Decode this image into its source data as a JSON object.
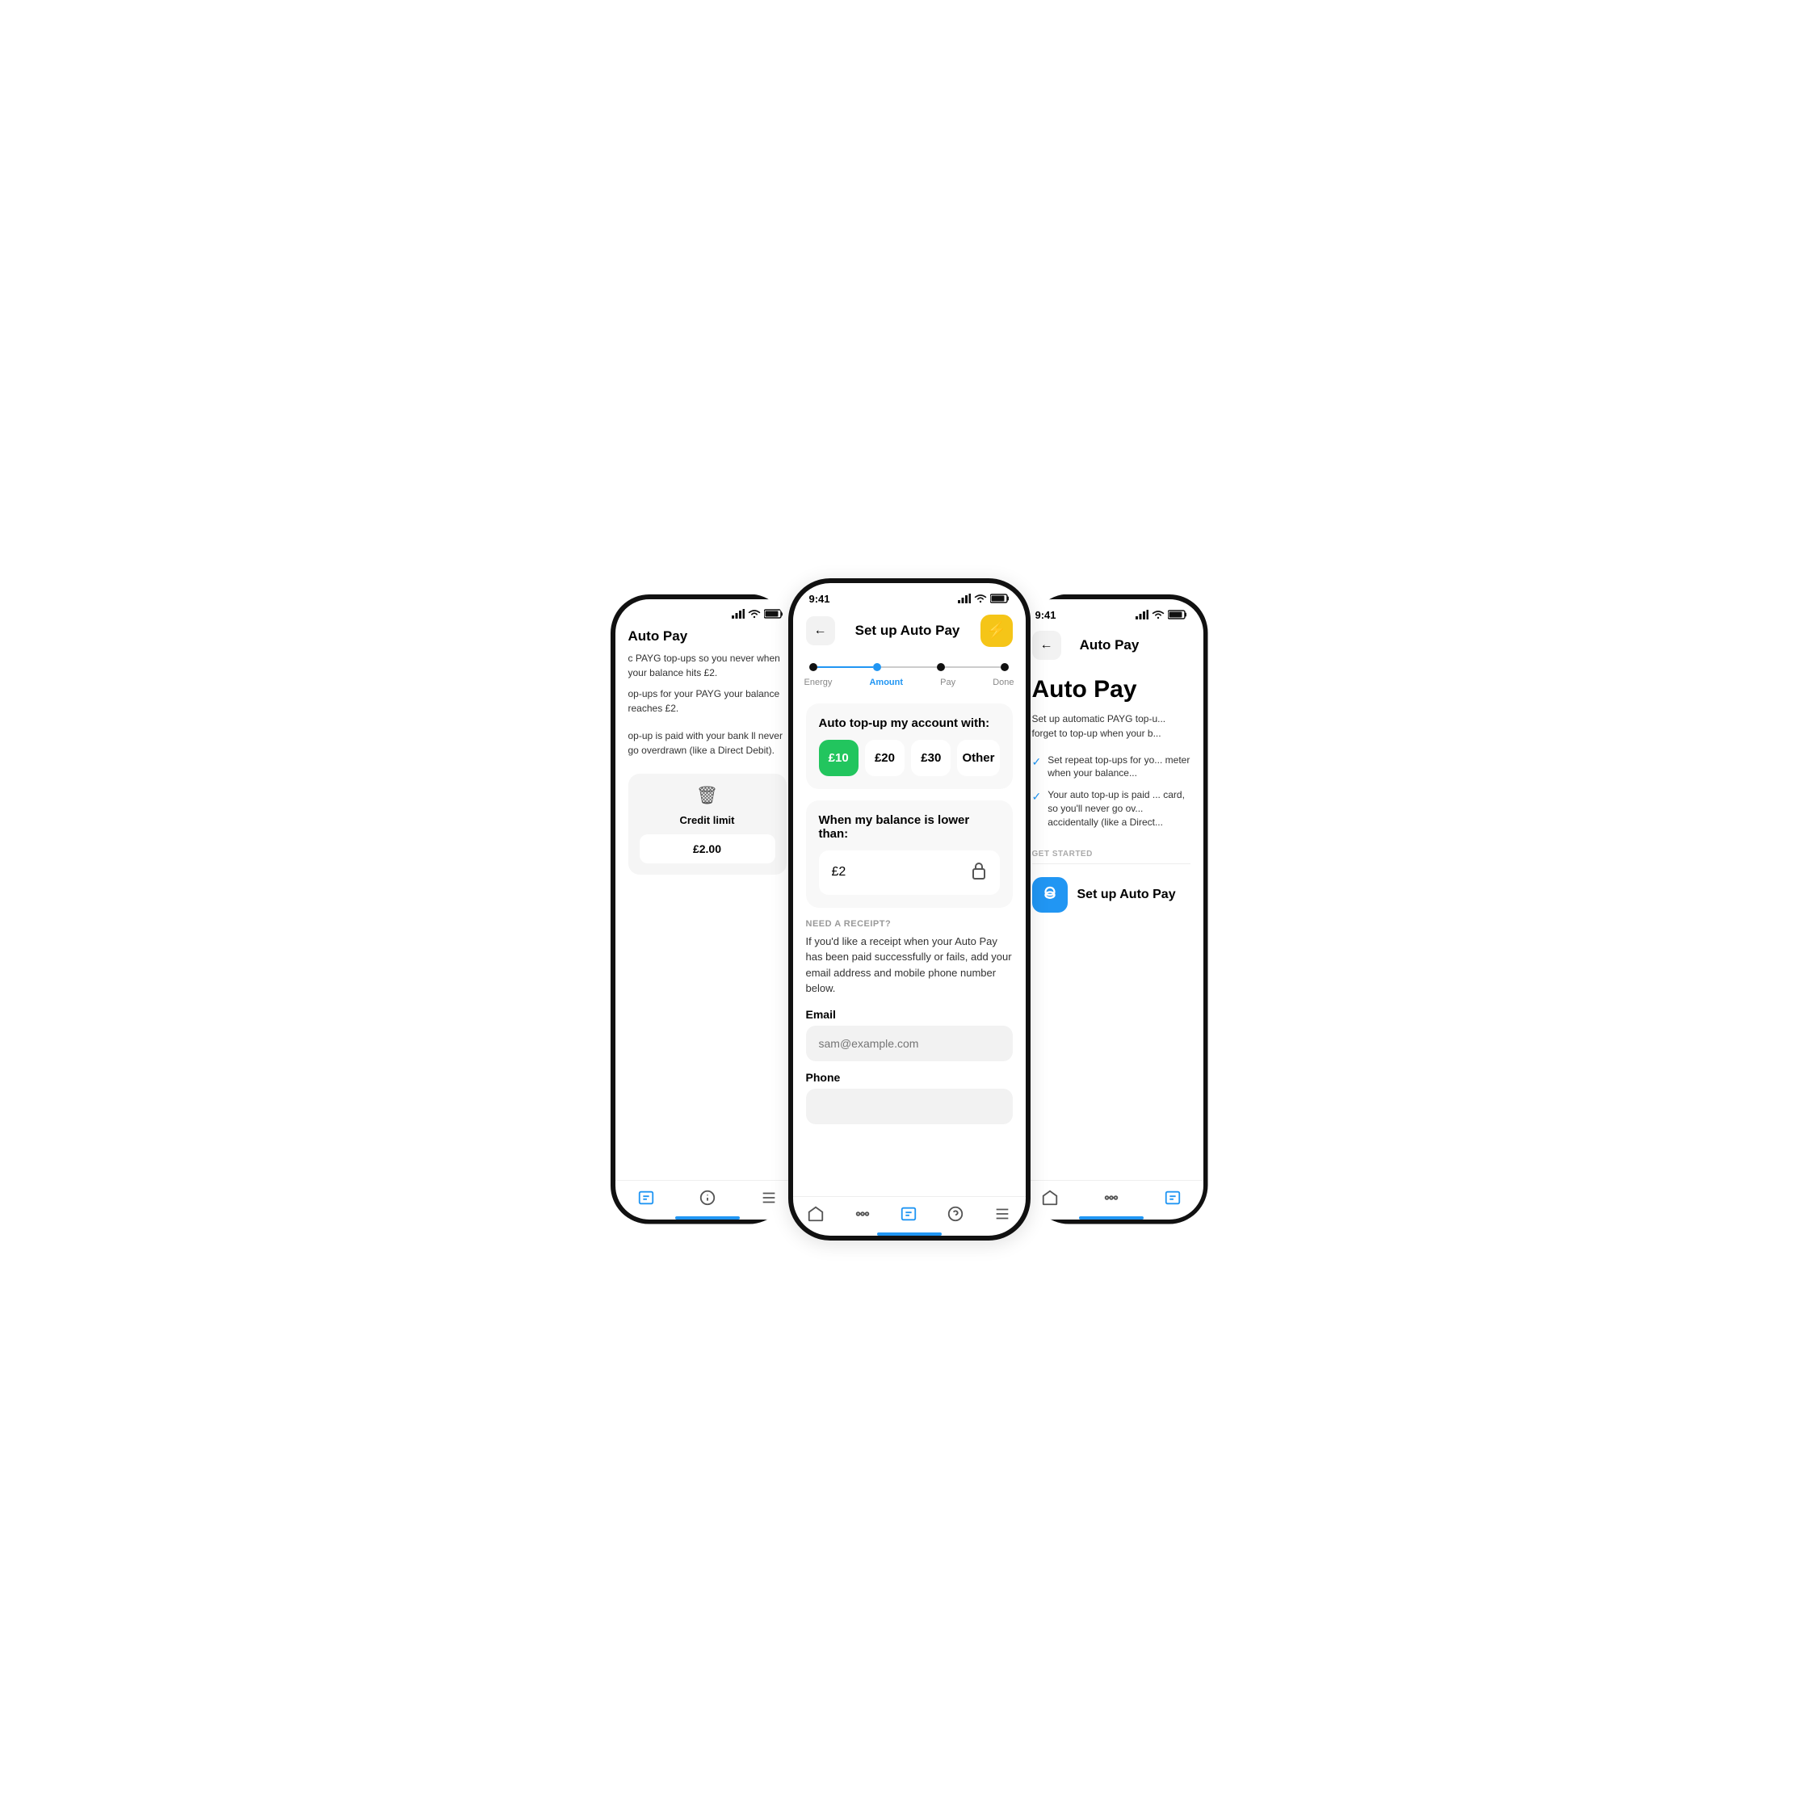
{
  "left_phone": {
    "title": "Auto Pay",
    "desc1": "c PAYG top-ups so you never when your balance hits £2.",
    "desc2": "op-ups for your PAYG your balance reaches £2.",
    "desc3": "op-up is paid with your bank ll never go overdrawn (like a Direct Debit).",
    "card": {
      "credit_label": "Credit limit",
      "credit_value": "£2.00"
    },
    "tabs": [
      "£",
      "?",
      "≡"
    ]
  },
  "center_phone": {
    "status_time": "9:41",
    "nav_back": "←",
    "nav_title": "Set up Auto Pay",
    "nav_action": "⚡",
    "steps": [
      {
        "label": "Energy",
        "active": false
      },
      {
        "label": "Amount",
        "active": true
      },
      {
        "label": "Pay",
        "active": false
      },
      {
        "label": "Done",
        "active": false
      }
    ],
    "top_up_section": {
      "title": "Auto top-up my account with:",
      "amounts": [
        {
          "label": "£10",
          "selected": true
        },
        {
          "label": "£20",
          "selected": false
        },
        {
          "label": "£30",
          "selected": false
        },
        {
          "label": "Other",
          "selected": false
        }
      ]
    },
    "balance_section": {
      "title": "When my balance is lower than:",
      "value": "£2"
    },
    "receipt_section": {
      "label": "NEED A RECEIPT?",
      "desc": "If you'd like a receipt when your Auto Pay has been paid successfully or fails, add your email address and mobile phone number below.",
      "email_label": "Email",
      "email_placeholder": "sam@example.com",
      "phone_label": "Phone"
    },
    "tabs": [
      "🏠",
      "⚙",
      "£",
      "?",
      "≡"
    ]
  },
  "right_phone": {
    "status_time": "9:41",
    "nav_back": "←",
    "nav_title": "Auto Pay",
    "title": "Auto Pay",
    "desc": "Set up automatic PAYG top-u... forget to top-up when your b...",
    "bullets": [
      "Set repeat top-ups for yo... meter when your balance...",
      "Your auto top-up is paid ... card, so you'll never go ov... accidentally (like a Direct..."
    ],
    "get_started_label": "GET STARTED",
    "setup_btn_label": "Set up Auto Pay",
    "tabs": [
      "🏠",
      "⚙",
      "£"
    ]
  }
}
